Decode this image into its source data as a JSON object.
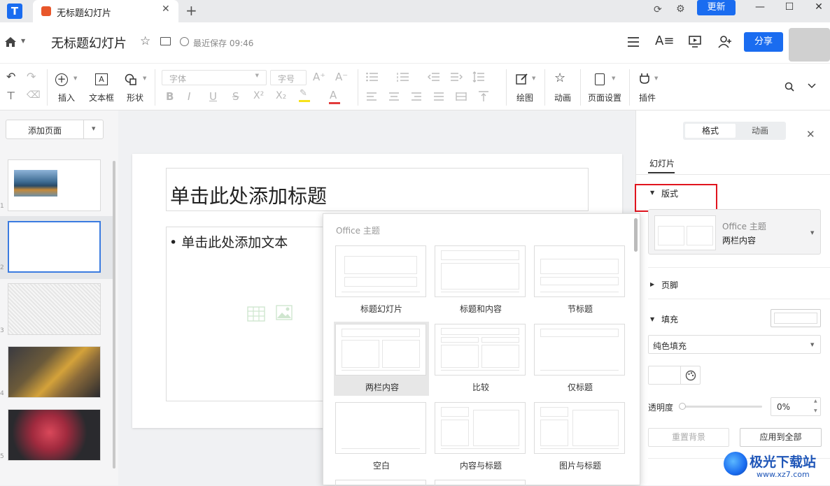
{
  "titlebar": {
    "tab_title": "无标题幻灯片",
    "update_label": "更新"
  },
  "header": {
    "doc_title": "无标题幻灯片",
    "save_status": "最近保存 09:46",
    "share_label": "分享"
  },
  "toolbar": {
    "insert": "插入",
    "textbox": "文本框",
    "shape": "形状",
    "font_placeholder": "字体",
    "size_placeholder": "字号",
    "draw": "绘图",
    "animation": "动画",
    "page_setup": "页面设置",
    "plugin": "插件"
  },
  "left_panel": {
    "add_page_label": "添加页面",
    "slide_numbers": [
      "1",
      "2",
      "3",
      "4",
      "5"
    ]
  },
  "slide": {
    "title_placeholder": "单击此处添加标题",
    "body_placeholder": "• 单击此处添加文本"
  },
  "layout_dropdown": {
    "theme_label": "Office 主题",
    "layouts": [
      "标题幻灯片",
      "标题和内容",
      "节标题",
      "两栏内容",
      "比较",
      "仅标题",
      "空白",
      "内容与标题",
      "图片与标题"
    ],
    "selected": "两栏内容"
  },
  "right_panel": {
    "tabs": [
      "格式",
      "动画"
    ],
    "active_tab": "格式",
    "subtab": "幻灯片",
    "layout_section": "版式",
    "layout_theme": "Office 主题",
    "layout_name": "两栏内容",
    "footer_section": "页脚",
    "fill_section": "填充",
    "fill_type": "纯色填充",
    "transparency_label": "透明度",
    "transparency_value": "0%",
    "reset_bg_label": "重置背景",
    "apply_all_label": "应用到全部"
  },
  "watermark": {
    "site_name": "极光下载站",
    "site_url": "www.xz7.com"
  },
  "colors": {
    "accent": "#1a6cf0",
    "highlight_box": "#e0141e"
  }
}
